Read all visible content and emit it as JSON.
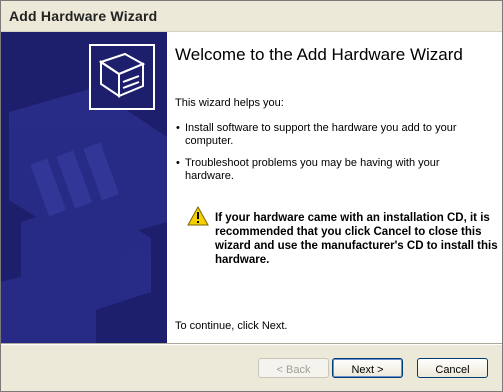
{
  "window": {
    "title": "Add Hardware Wizard"
  },
  "main": {
    "heading": "Welcome to the Add Hardware Wizard",
    "intro": "This wizard helps you:",
    "bullets": [
      "Install software to support the hardware you add to your computer.",
      "Troubleshoot problems you may be having with your hardware."
    ],
    "warning": "If your hardware came with an installation CD, it is recommended that you click Cancel to close this wizard and use the manufacturer's CD to install this hardware.",
    "continue_text": "To continue, click Next."
  },
  "buttons": {
    "back": "< Back",
    "next": "Next >",
    "cancel": "Cancel"
  },
  "colors": {
    "sidebar": "#1d1f6d",
    "dialog_bg": "#ece9d8",
    "warning_yellow": "#f6d100"
  },
  "icons": {
    "logo": "hardware-card-icon",
    "warning": "warning-icon"
  }
}
